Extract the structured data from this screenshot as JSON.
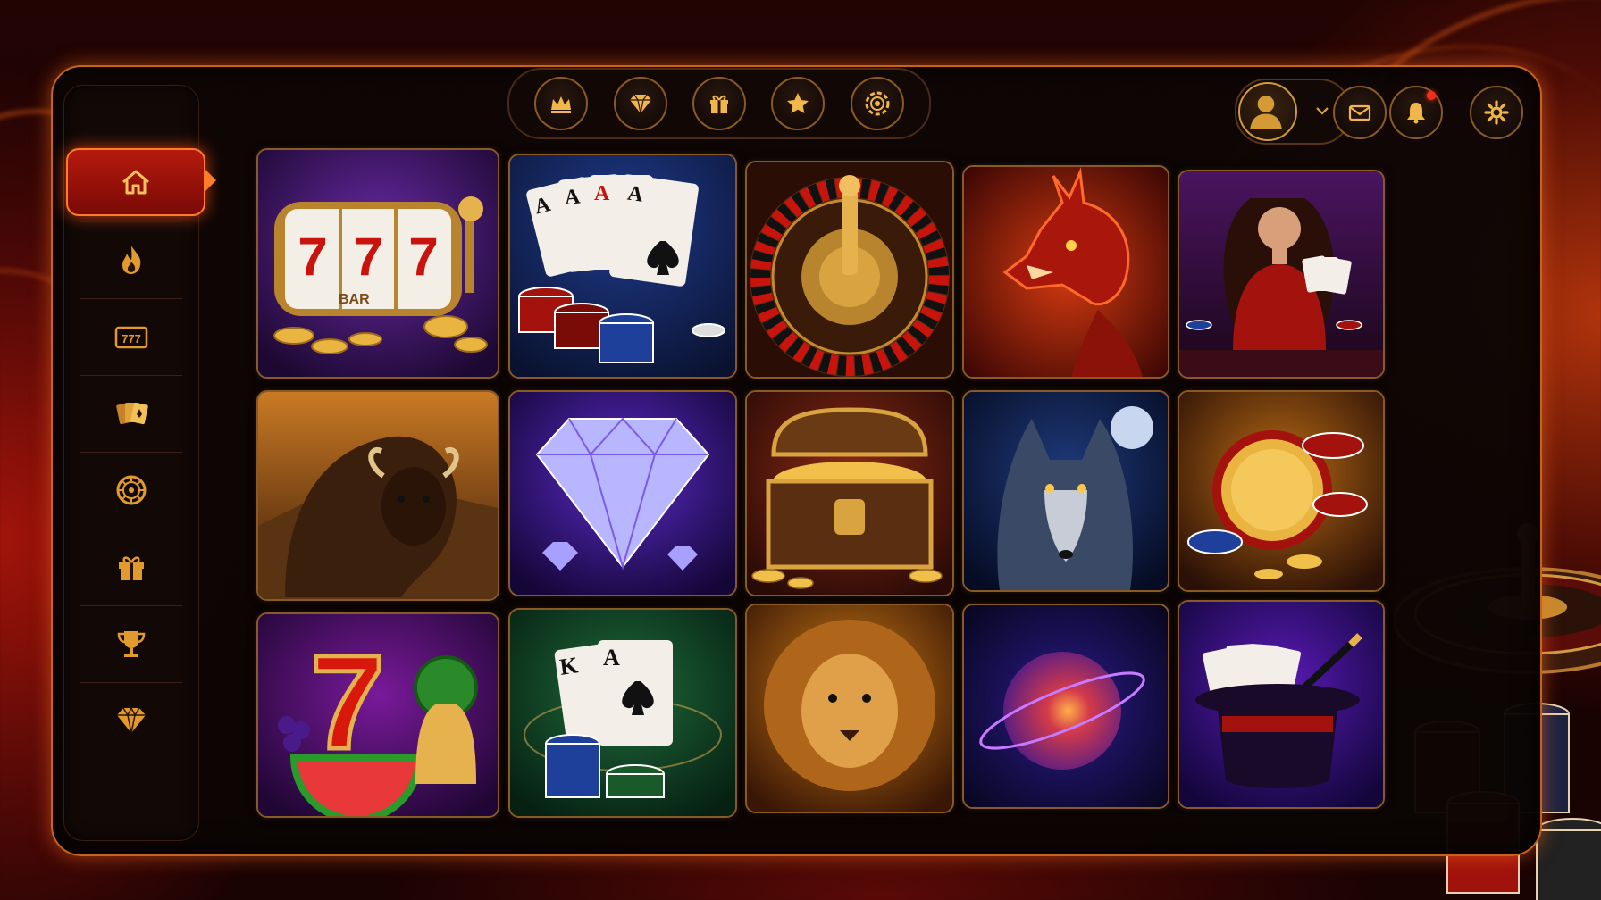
{
  "colors": {
    "accent_gold": "#e0a53a",
    "accent_red": "#b51a0e",
    "panel_border": "#c9621e",
    "background": "#160303"
  },
  "sidebar": {
    "items": [
      {
        "name": "home",
        "icon": "home-icon",
        "active": true
      },
      {
        "name": "hot",
        "icon": "flame-icon",
        "active": false
      },
      {
        "name": "slots",
        "icon": "slot-777-icon",
        "active": false
      },
      {
        "name": "cards",
        "icon": "playing-cards-icon",
        "active": false
      },
      {
        "name": "roulette",
        "icon": "roulette-wheel-icon",
        "active": false
      },
      {
        "name": "bonus",
        "icon": "gift-icon",
        "active": false
      },
      {
        "name": "tournaments",
        "icon": "trophy-icon",
        "active": false
      },
      {
        "name": "vip",
        "icon": "diamond-icon",
        "active": false
      }
    ]
  },
  "topnav": {
    "items": [
      {
        "name": "crown",
        "icon": "crown-icon"
      },
      {
        "name": "diamond",
        "icon": "diamond-icon"
      },
      {
        "name": "gift",
        "icon": "gift-icon"
      },
      {
        "name": "favorites",
        "icon": "star-icon"
      },
      {
        "name": "chip",
        "icon": "casino-chip-icon"
      }
    ]
  },
  "user": {
    "avatar_icon": "user-avatar-icon",
    "menu_icon": "chevron-down-icon",
    "messages_icon": "envelope-icon",
    "notifications_icon": "bell-icon",
    "notifications_unread": true,
    "settings_icon": "gear-icon"
  },
  "games": [
    {
      "art": "slot-machine-777",
      "row": 1,
      "col": 1,
      "reel_text": "BAR"
    },
    {
      "art": "poker-aces-chips",
      "row": 1,
      "col": 2,
      "card_ranks": [
        "A",
        "A",
        "A",
        "A"
      ]
    },
    {
      "art": "roulette-wheel",
      "row": 1,
      "col": 3
    },
    {
      "art": "red-dragon",
      "row": 1,
      "col": 4
    },
    {
      "art": "live-dealer-cards",
      "row": 1,
      "col": 5
    },
    {
      "art": "buffalo-sunset",
      "row": 2,
      "col": 1
    },
    {
      "art": "purple-diamond",
      "row": 2,
      "col": 2
    },
    {
      "art": "treasure-chest-gold",
      "row": 2,
      "col": 3
    },
    {
      "art": "wolf-moon",
      "row": 2,
      "col": 4
    },
    {
      "art": "gold-coin-chips",
      "row": 2,
      "col": 5
    },
    {
      "art": "fruit-seven-bell",
      "row": 3,
      "col": 1,
      "symbol_text": "7"
    },
    {
      "art": "blackjack-king-ace",
      "row": 3,
      "col": 2,
      "card_ranks": [
        "K",
        "A"
      ]
    },
    {
      "art": "golden-lion",
      "row": 3,
      "col": 3
    },
    {
      "art": "cosmic-planet",
      "row": 3,
      "col": 4
    },
    {
      "art": "magic-hat-cards",
      "row": 3,
      "col": 5
    }
  ],
  "decor": {
    "slot_reel_numbers": [
      "7",
      "7",
      "7"
    ]
  }
}
